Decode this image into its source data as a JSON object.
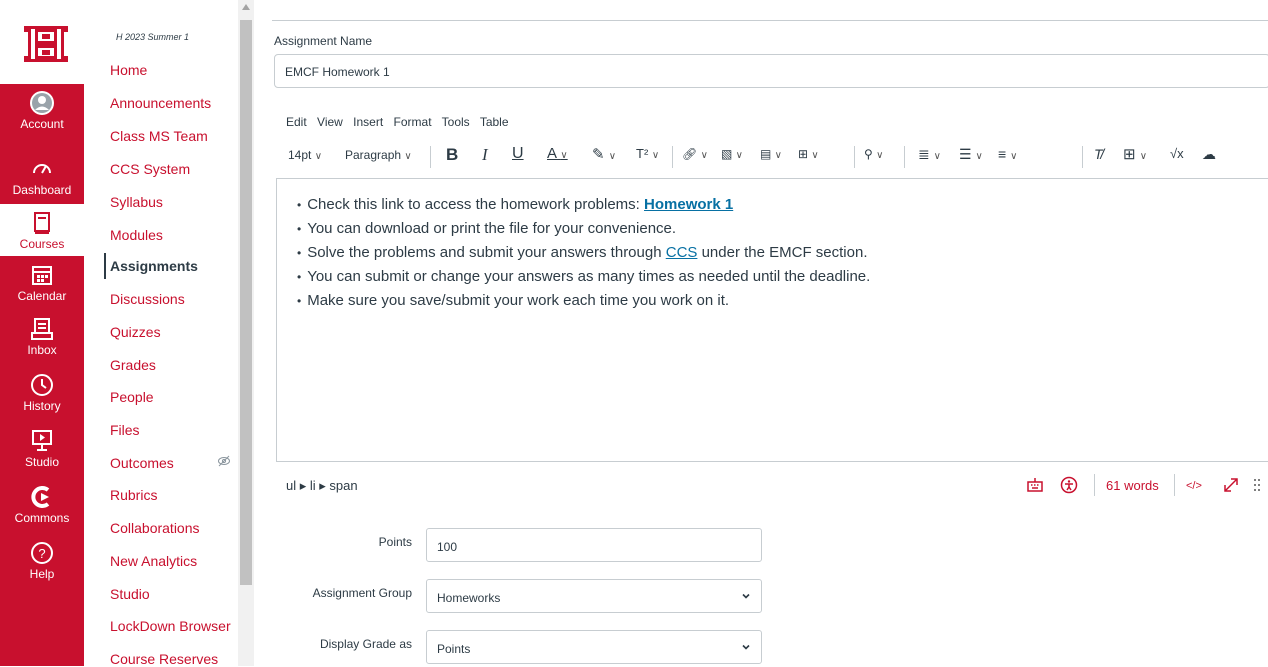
{
  "global_nav": {
    "logo_alt": "UH",
    "items": [
      {
        "label": "Account",
        "icon": "account-icon"
      },
      {
        "label": "Dashboard",
        "icon": "dashboard-icon"
      },
      {
        "label": "Courses",
        "icon": "courses-icon"
      },
      {
        "label": "Calendar",
        "icon": "calendar-icon"
      },
      {
        "label": "Inbox",
        "icon": "inbox-icon"
      },
      {
        "label": "History",
        "icon": "history-icon"
      },
      {
        "label": "Studio",
        "icon": "studio-icon"
      },
      {
        "label": "Commons",
        "icon": "commons-icon"
      },
      {
        "label": "Help",
        "icon": "help-icon"
      }
    ]
  },
  "course_nav": {
    "term": "H 2023 Summer 1",
    "items": [
      "Home",
      "Announcements",
      "Class MS Team",
      "CCS System",
      "Syllabus",
      "Modules",
      "Assignments",
      "Discussions",
      "Quizzes",
      "Grades",
      "People",
      "Files",
      "Outcomes",
      "Rubrics",
      "Collaborations",
      "New Analytics",
      "Studio",
      "LockDown Browser",
      "Course Reserves"
    ],
    "active": "Assignments"
  },
  "form": {
    "assignment_name_label": "Assignment Name",
    "assignment_name_value": "EMCF Homework 1"
  },
  "editor": {
    "menu": [
      "Edit",
      "View",
      "Insert",
      "Format",
      "Tools",
      "Table"
    ],
    "font_size": "14pt",
    "block_format": "Paragraph",
    "bullets": [
      {
        "before": "Check this link to access the homework problems: ",
        "link": "Homework 1",
        "after": ""
      },
      {
        "before": "You can download or print the file for your convenience.",
        "link": "",
        "after": ""
      },
      {
        "before": "Solve the problems and submit your answers through ",
        "link": "CCS",
        "after": " under the EMCF section."
      },
      {
        "before": "You can submit or change your answers as many times as needed until the deadline.",
        "link": "",
        "after": ""
      },
      {
        "before": "Make sure you save/submit your work each time you work on it.",
        "link": "",
        "after": ""
      }
    ],
    "path": "ul ▸ li ▸ span",
    "word_count": "61 words",
    "html_toggle": "</>"
  },
  "settings": {
    "points_label": "Points",
    "points_value": "100",
    "group_label": "Assignment Group",
    "group_value": "Homeworks",
    "display_label": "Display Grade as",
    "display_value": "Points"
  },
  "colors": {
    "brand": "#c8102e",
    "link": "#0770a3",
    "text": "#2d3b45"
  }
}
